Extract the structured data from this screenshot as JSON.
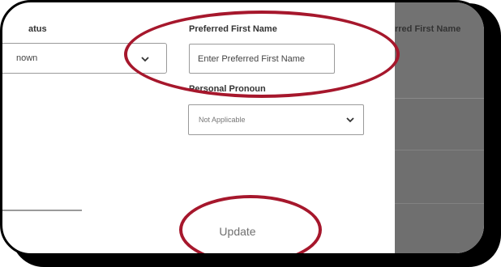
{
  "form": {
    "left_field": {
      "label": "atus",
      "value": "nown"
    },
    "preferred_first_name": {
      "label": "Preferred First Name",
      "placeholder": "Enter Preferred First Name",
      "value": ""
    },
    "personal_pronoun": {
      "label": "Personal Pronoun",
      "value": "Not Applicable"
    },
    "update_label": "Update"
  },
  "background_panel": {
    "label": "rred First Name"
  },
  "annotation": {
    "color": "#a6172c"
  },
  "icons": {
    "select_chevron": "chevron-down-icon"
  }
}
